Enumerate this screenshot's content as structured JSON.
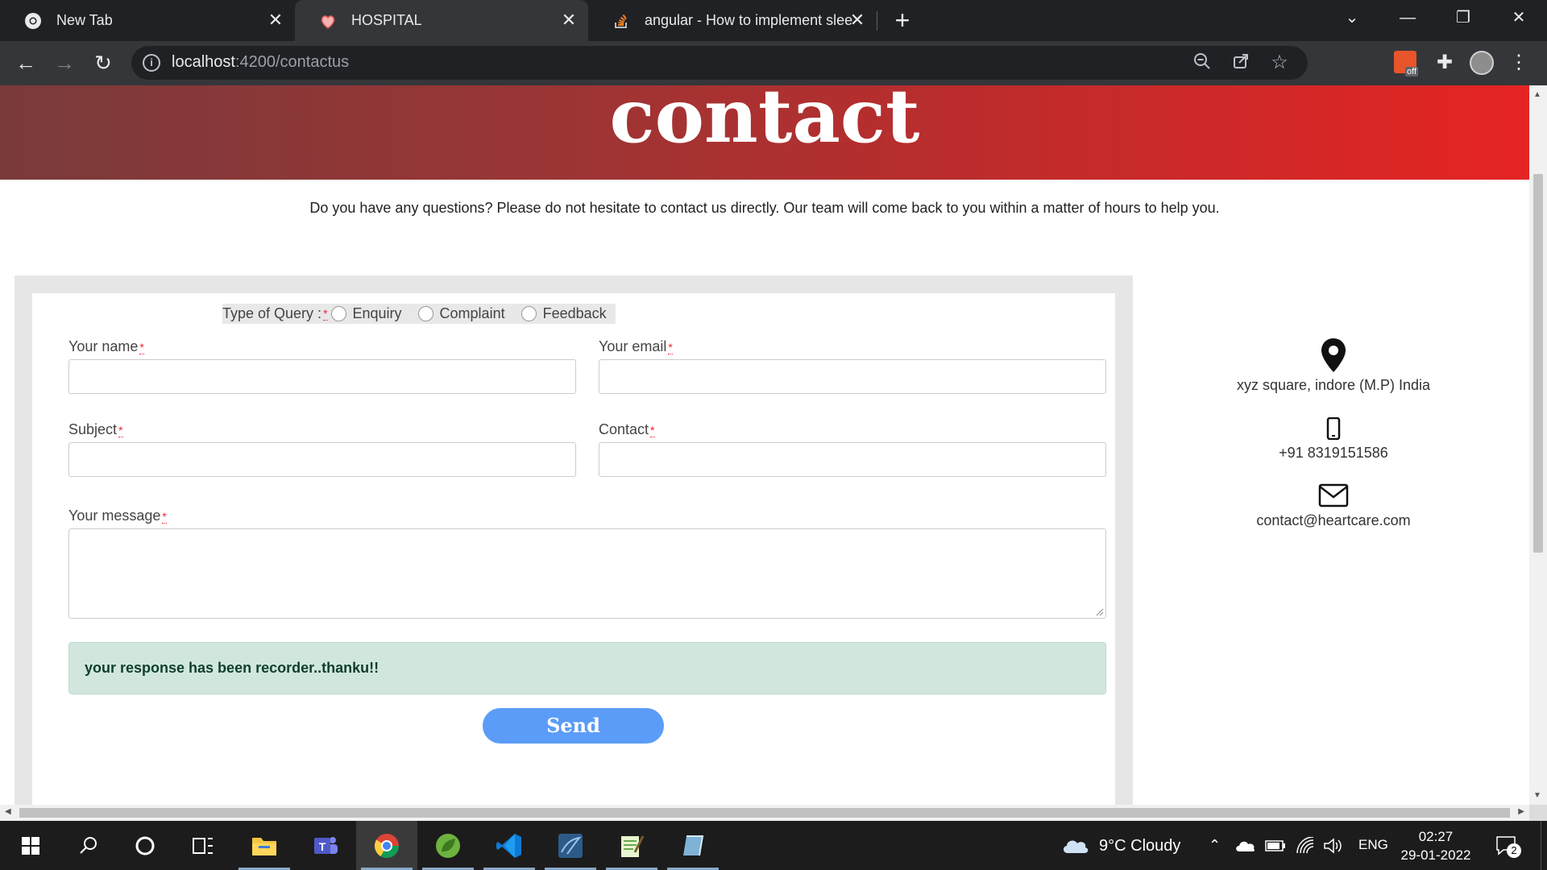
{
  "browser": {
    "tabs": [
      {
        "label": "New Tab",
        "icon": "chrome-icon"
      },
      {
        "label": "HOSPITAL",
        "icon": "hospital-favicon"
      },
      {
        "label": "angular - How to implement slee",
        "icon": "stackoverflow-icon"
      }
    ],
    "url_host": "localhost",
    "url_rest": ":4200/contactus",
    "extension_badge": "off"
  },
  "page": {
    "hero_title": "contact",
    "intro": "Do you have any questions? Please do not hesitate to contact us directly. Our team will come back to you within a matter of hours to help you.",
    "form": {
      "query_label": "Type of Query :",
      "query_options": [
        "Enquiry",
        "Complaint",
        "Feedback"
      ],
      "name_label": "Your name",
      "email_label": "Your email",
      "subject_label": "Subject",
      "contact_label": "Contact",
      "message_label": "Your message",
      "required_mark": "*",
      "success_message": "your response has been recorder..thanku!!",
      "send_label": "Send"
    },
    "contact_info": {
      "address": "xyz square, indore (M.P) India",
      "phone": "+91 8319151586",
      "email": "contact@heartcare.com"
    }
  },
  "taskbar": {
    "weather": "9°C  Cloudy",
    "language": "ENG",
    "time": "02:27",
    "date": "29-01-2022",
    "notifications": "2"
  },
  "colors": {
    "hero_start": "#7a3a3a",
    "hero_end": "#e52424",
    "send_button": "#5b9cf8",
    "alert_bg": "#d1e7dd"
  }
}
